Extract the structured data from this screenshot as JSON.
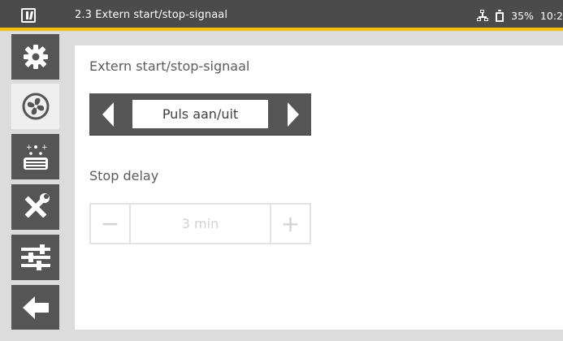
{
  "app": {
    "title": "2.3 Extern start/stop-signaal"
  },
  "status": {
    "battery_percent": "35%",
    "time": "10:2",
    "icons": [
      "network-icon",
      "battery-icon"
    ]
  },
  "sidebar": {
    "items": [
      {
        "name": "settings",
        "icon": "gear-icon",
        "active": false
      },
      {
        "name": "fan",
        "icon": "fan-icon",
        "active": true
      },
      {
        "name": "filter",
        "icon": "filter-icon",
        "active": false
      },
      {
        "name": "service",
        "icon": "tools-icon",
        "active": false
      },
      {
        "name": "adjustments",
        "icon": "sliders-icon",
        "active": false
      },
      {
        "name": "back",
        "icon": "back-arrow-icon",
        "active": false
      }
    ]
  },
  "main": {
    "section_label": "Extern start/stop-signaal",
    "selector_value": "Puls aan/uit",
    "stop_delay_label": "Stop delay",
    "stop_delay_value": "3 min",
    "stepper_disabled": true
  },
  "colors": {
    "topbar": "#4b4b4b",
    "accent": "#f2c300",
    "sidebar_tab": "#555555",
    "active_tab": "#efefef",
    "disabled_text": "#d2d2d2"
  }
}
